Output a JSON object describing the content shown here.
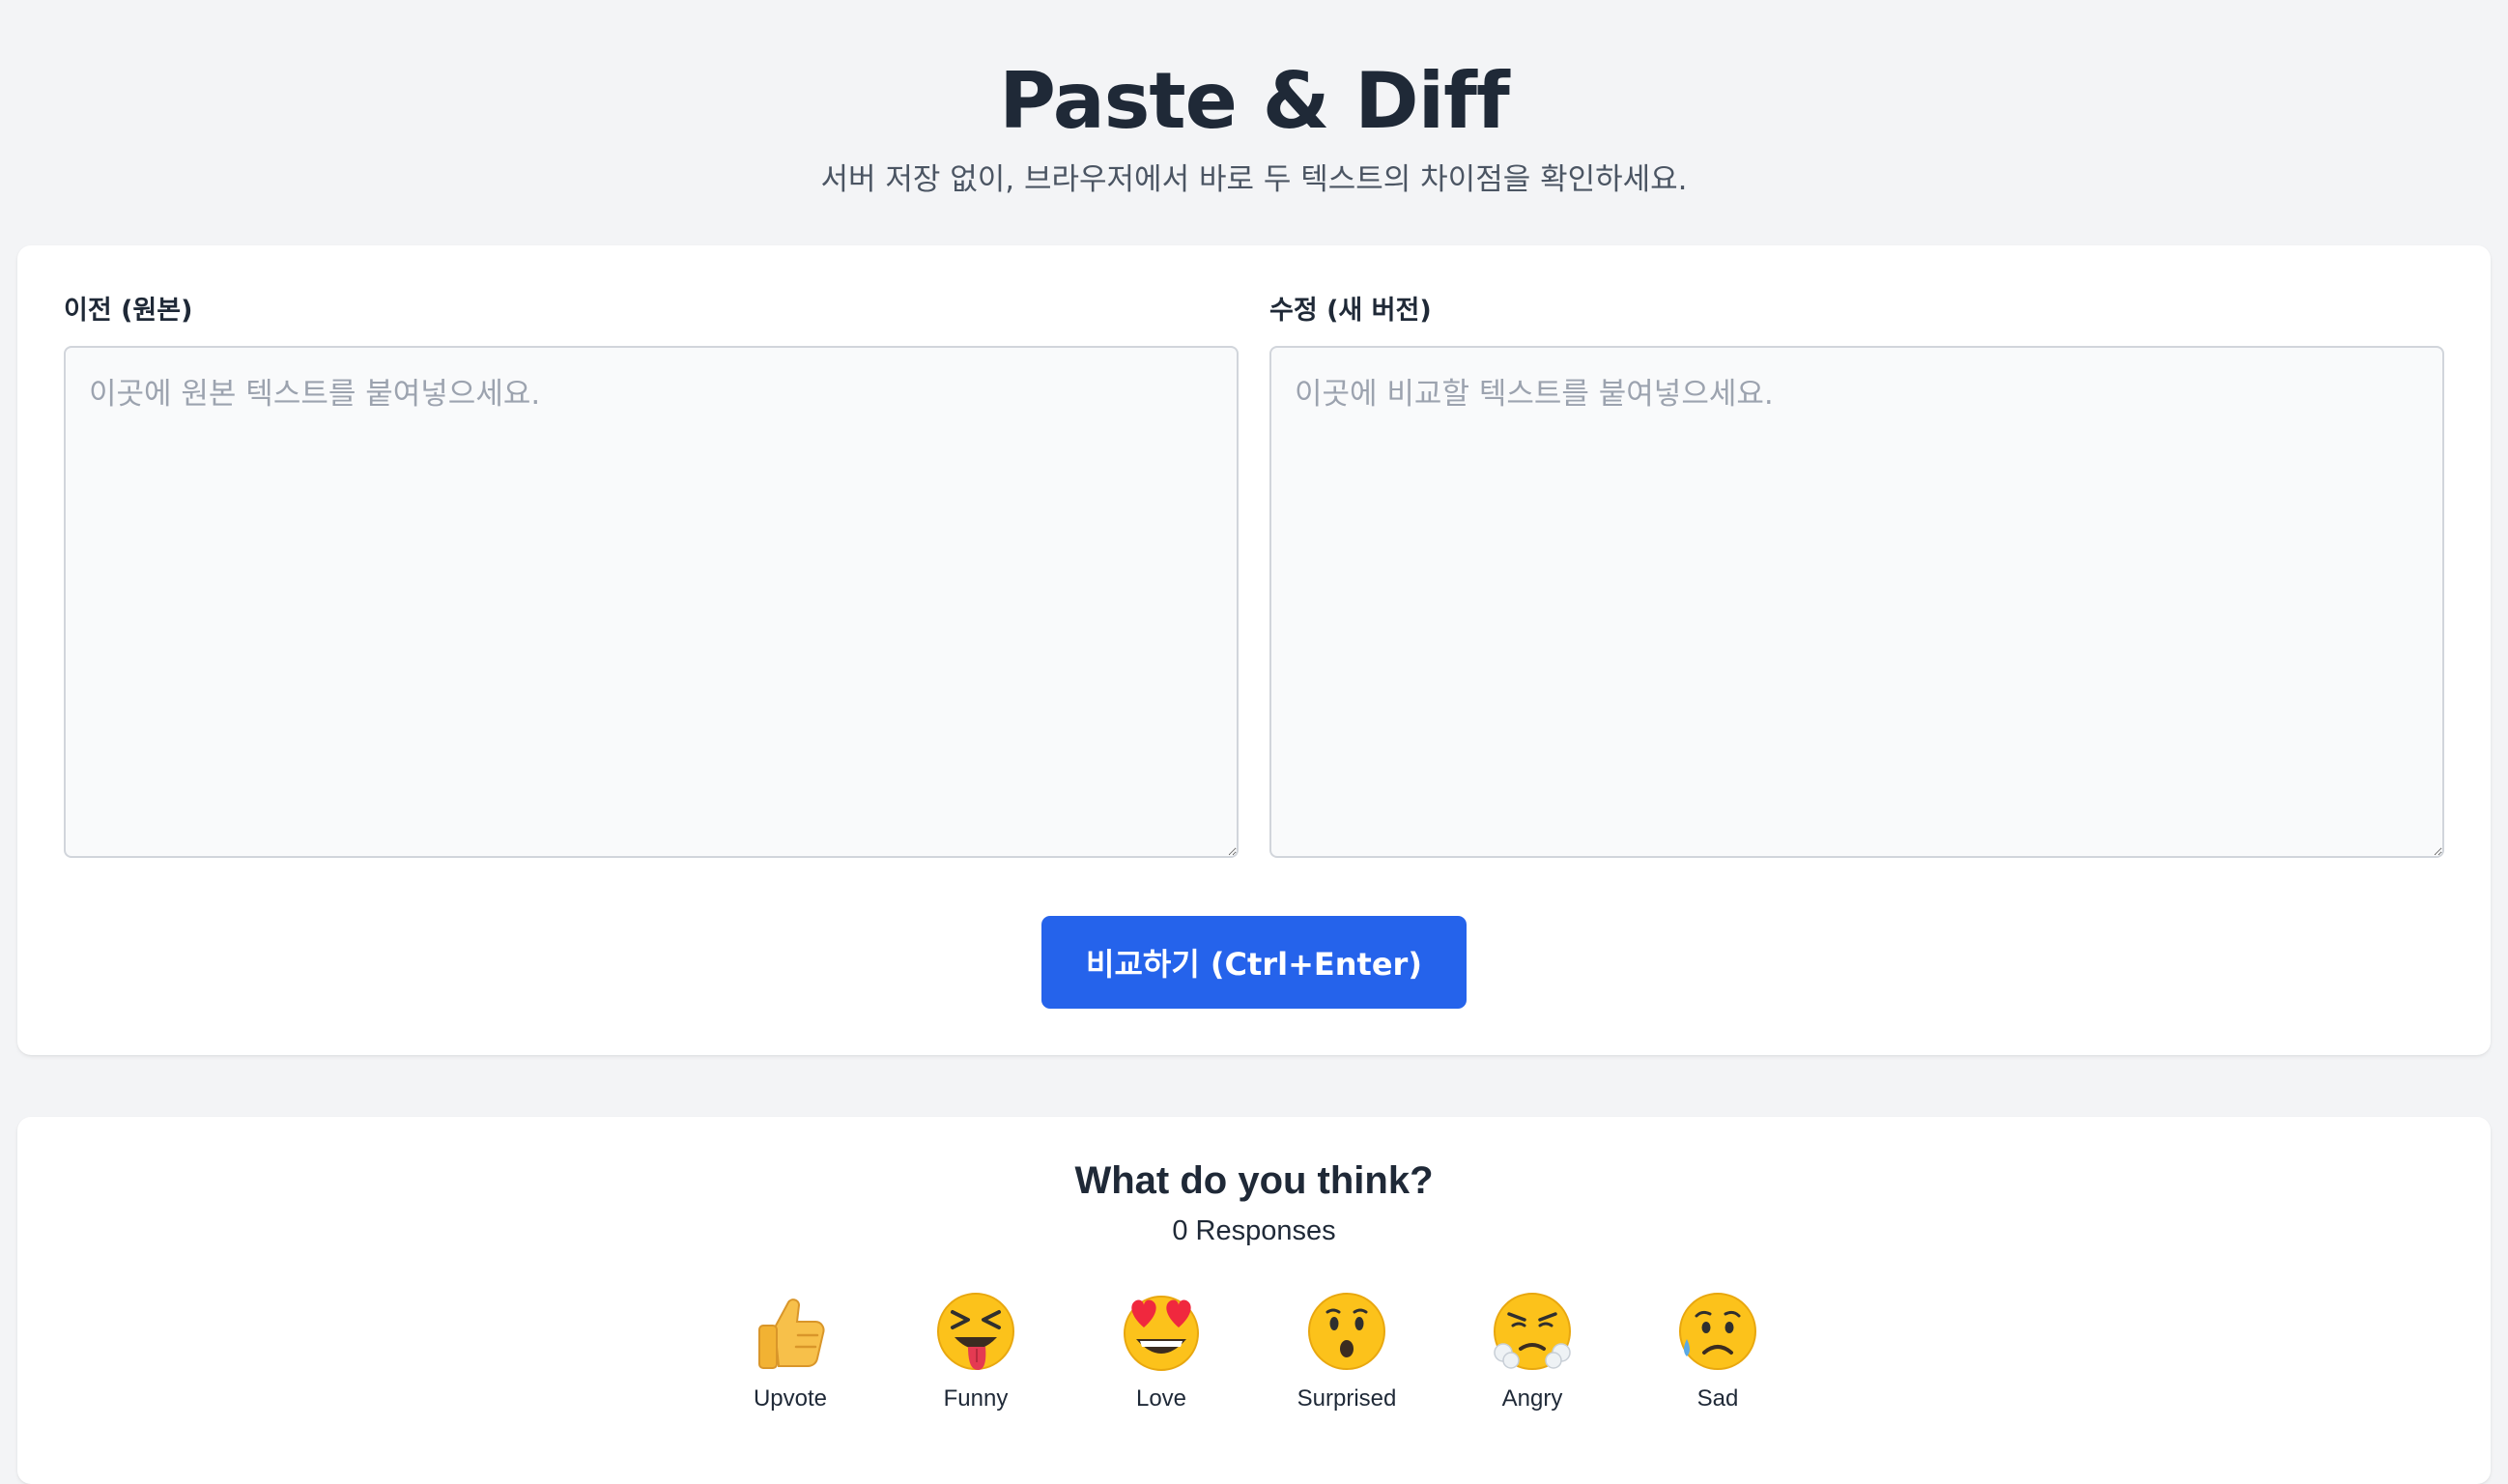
{
  "header": {
    "title": "Paste & Diff",
    "subtitle": "서버 저장 없이, 브라우저에서 바로 두 텍스트의 차이점을 확인하세요."
  },
  "editor": {
    "left_label": "이전 (원본)",
    "left_placeholder": "이곳에 원본 텍스트를 붙여넣으세요.",
    "left_value": "",
    "right_label": "수정 (새 버전)",
    "right_placeholder": "이곳에 비교할 텍스트를 붙여넣으세요.",
    "right_value": "",
    "compare_button": "비교하기 (Ctrl+Enter)"
  },
  "feedback": {
    "title": "What do you think?",
    "responses": "0 Responses",
    "reactions": [
      {
        "label": "Upvote",
        "icon": "thumbs-up-icon"
      },
      {
        "label": "Funny",
        "icon": "squinting-tongue-face-icon"
      },
      {
        "label": "Love",
        "icon": "heart-eyes-face-icon"
      },
      {
        "label": "Surprised",
        "icon": "hushed-face-icon"
      },
      {
        "label": "Angry",
        "icon": "steaming-face-icon"
      },
      {
        "label": "Sad",
        "icon": "sad-sweat-face-icon"
      }
    ]
  },
  "colors": {
    "page_background": "#f3f4f6",
    "card_background": "#ffffff",
    "primary_button": "#2563eb",
    "text_primary": "#1f2937",
    "text_secondary": "#4b5563",
    "placeholder": "#9ca3af"
  }
}
